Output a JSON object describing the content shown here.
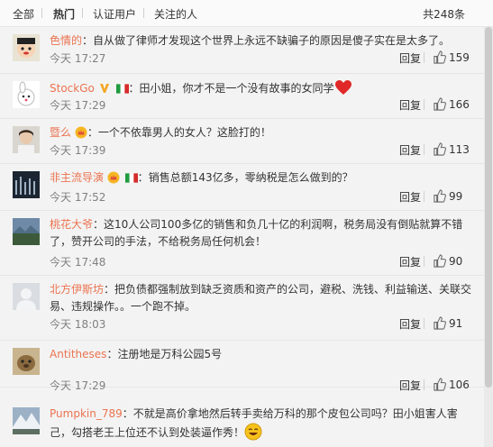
{
  "tabs": {
    "all": "全部",
    "hot": "热门",
    "verified": "认证用户",
    "followed": "关注的人",
    "total": "共248条"
  },
  "actions": {
    "reply": "回复"
  },
  "comments": [
    {
      "name": "色情的",
      "sep": "：",
      "text": "自从做了律师才发现这个世界上永远不缺骗子的原因是傻子实在是太多了。",
      "time": "今天 17:27",
      "likes": "159"
    },
    {
      "name": "StockGo",
      "sep": "：",
      "text": "田小姐，你才不是一个没有故事的女同学",
      "time": "今天 17:29",
      "likes": "166"
    },
    {
      "name": "暨么",
      "sep": "：",
      "text": "一个不依靠男人的女人？这脸打的！",
      "time": "今天 17:39",
      "likes": "113"
    },
    {
      "name": "非主流导演",
      "sep": "：",
      "text": "销售总额143亿多，零纳税是怎么做到的？",
      "time": "今天 17:52",
      "likes": "99"
    },
    {
      "name": "桃花大爷",
      "sep": "：",
      "text": "这10人公司100多亿的销售和负几十亿的利润啊，税务局没有倒贴就算不错了，赞开公司的手法，不给税务局任何机会！",
      "time": "今天 17:48",
      "likes": "90"
    },
    {
      "name": "北方伊斯坊",
      "sep": "：",
      "text": "把负债都强制放到缺乏资质和资产的公司，避税、洗钱、利益输送、关联交易、违规操作。。一个跑不掉。",
      "time": "今天 18:03",
      "likes": "91"
    },
    {
      "name": "Antitheses",
      "sep": "：",
      "text": "注册地是万科公园5号",
      "time": "今天 17:29",
      "likes": "106"
    },
    {
      "name": "Pumpkin_789",
      "sep": "：",
      "text": "不就是高价拿地然后转手卖给万科的那个皮包公司吗？田小姐害人害己，勾搭老王上位还不认到处装逼作秀！",
      "time": "",
      "likes": ""
    }
  ],
  "colors": {
    "name": "#eb7350",
    "meta": "#808080",
    "text": "#333333"
  },
  "icons": {
    "like": "thumbs-up-icon",
    "badge_verified": "verified-v-icon",
    "badge_vip": "vip-crown-icon",
    "flag": "italy-flag-icon",
    "heart": "heart-emoji",
    "laugh": "laugh-emoji"
  }
}
